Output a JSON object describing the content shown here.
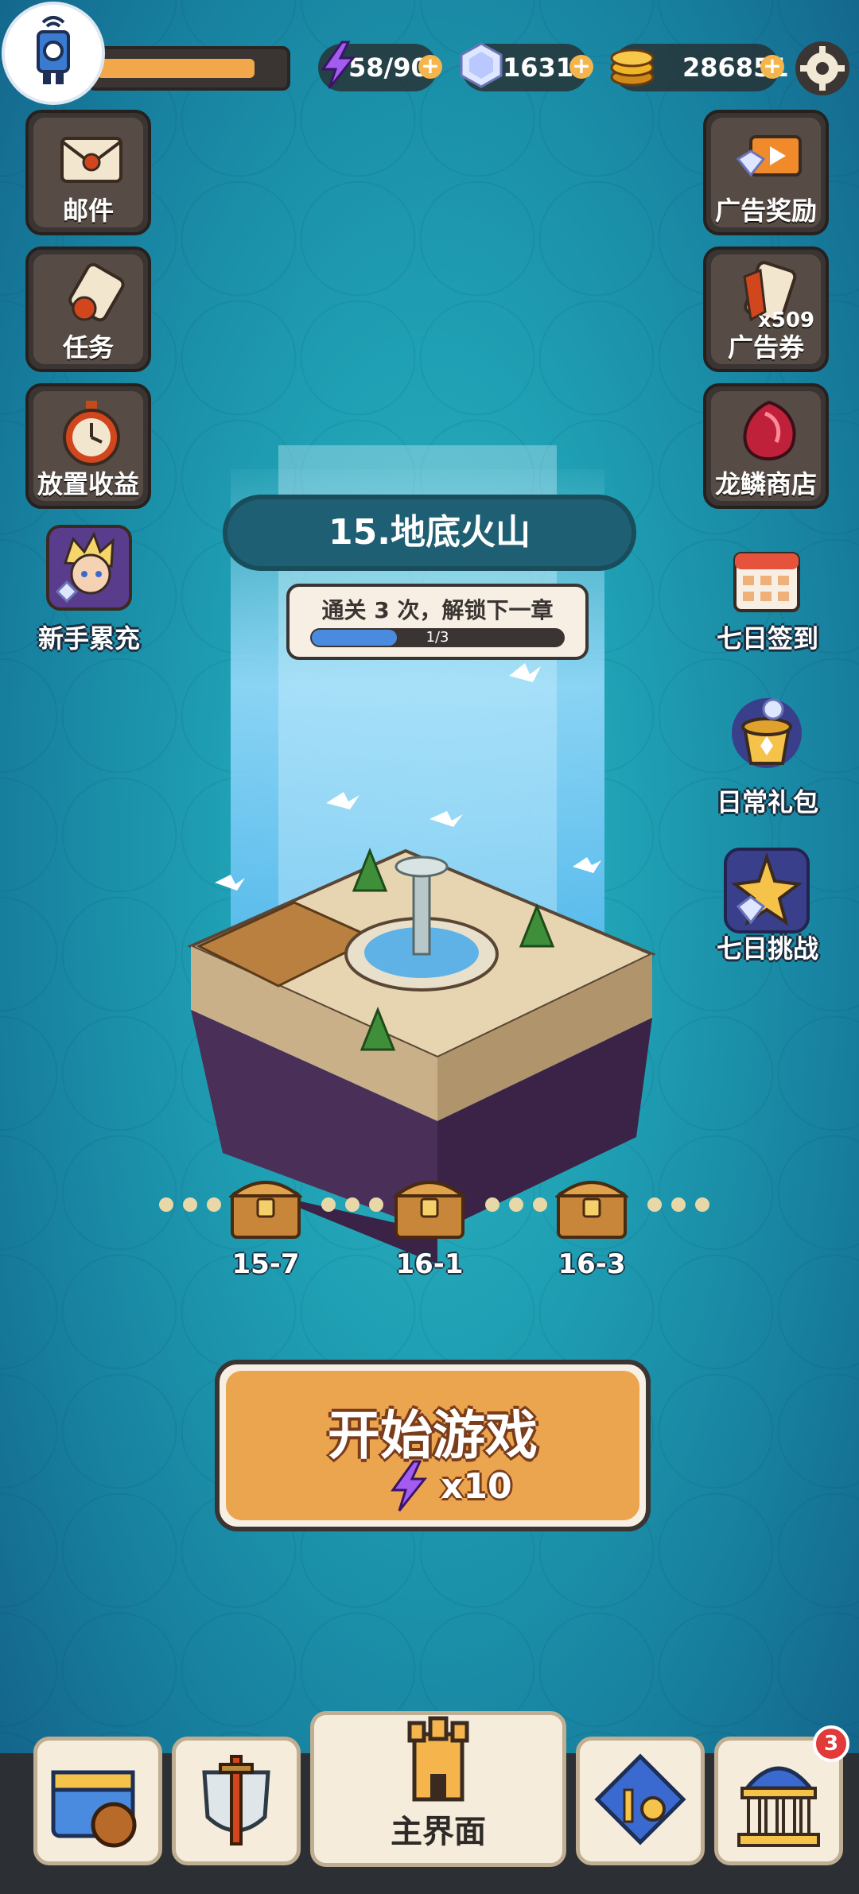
{
  "top_bar": {
    "xp_progress": 0.85,
    "energy": "58/90",
    "gems": "16311",
    "coins": "286851"
  },
  "left_menu": [
    {
      "label": "邮件",
      "icon": "mail-icon"
    },
    {
      "label": "任务",
      "icon": "scroll-icon"
    },
    {
      "label": "放置收益",
      "icon": "stopwatch-icon"
    },
    {
      "label": "新手累充",
      "icon": "hero-portrait-icon"
    }
  ],
  "right_menu": [
    {
      "label": "广告奖励",
      "icon": "tv-ad-icon"
    },
    {
      "label": "广告券",
      "icon": "ad-ticket-icon",
      "count": "x509"
    },
    {
      "label": "龙鳞商店",
      "icon": "dragon-scale-icon"
    },
    {
      "label": "七日签到",
      "icon": "calendar-icon"
    },
    {
      "label": "日常礼包",
      "icon": "gift-pot-icon"
    },
    {
      "label": "七日挑战",
      "icon": "challenge-icon"
    }
  ],
  "stage": {
    "title": "15.地底火山",
    "tip": "通关 3 次，解锁下一章",
    "progress_text": "1/3",
    "progress": 0.333
  },
  "milestones": [
    "15-7",
    "16-1",
    "16-3"
  ],
  "start_button": {
    "label": "开始游戏",
    "cost": "x10"
  },
  "bottom_nav": {
    "main_label": "主界面",
    "badge": "3"
  },
  "colors": {
    "accent_orange": "#eba54f",
    "energy_purple": "#a35cf0"
  }
}
